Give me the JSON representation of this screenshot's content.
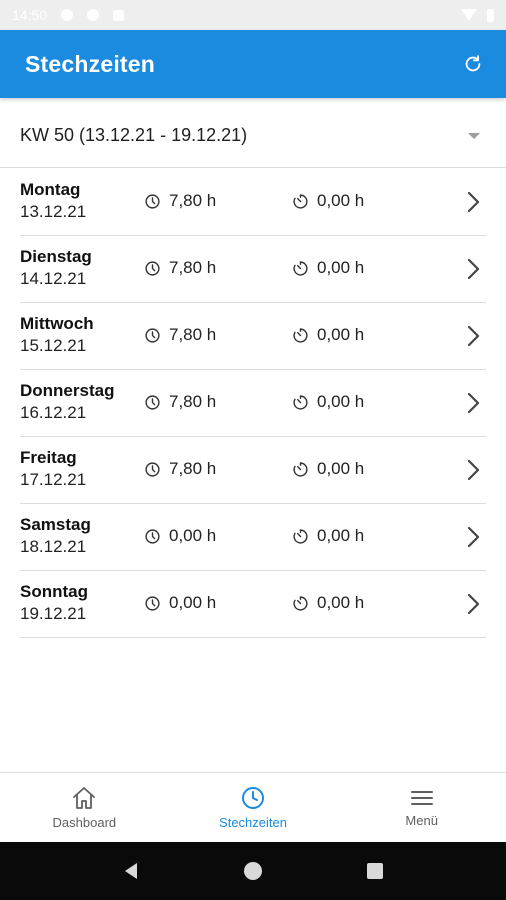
{
  "status_bar": {
    "time": "14:50",
    "icons": [
      "settings-icon",
      "location-icon",
      "notification-icon",
      "wifi-icon",
      "battery-icon"
    ]
  },
  "app_bar": {
    "title": "Stechzeiten",
    "refresh_icon": "refresh-icon",
    "color": "#1b8be0"
  },
  "week_select": {
    "label": "KW 50 (13.12.21 - 19.12.21)"
  },
  "days": [
    {
      "name": "Montag",
      "date": "13.12.21",
      "work": "7,80 h",
      "pause": "0,00 h"
    },
    {
      "name": "Dienstag",
      "date": "14.12.21",
      "work": "7,80 h",
      "pause": "0,00 h"
    },
    {
      "name": "Mittwoch",
      "date": "15.12.21",
      "work": "7,80 h",
      "pause": "0,00 h"
    },
    {
      "name": "Donnerstag",
      "date": "16.12.21",
      "work": "7,80 h",
      "pause": "0,00 h"
    },
    {
      "name": "Freitag",
      "date": "17.12.21",
      "work": "7,80 h",
      "pause": "0,00 h"
    },
    {
      "name": "Samstag",
      "date": "18.12.21",
      "work": "0,00 h",
      "pause": "0,00 h"
    },
    {
      "name": "Sonntag",
      "date": "19.12.21",
      "work": "0,00 h",
      "pause": "0,00 h"
    }
  ],
  "bottom_nav": {
    "items": [
      {
        "label": "Dashboard",
        "icon": "home-icon",
        "active": false
      },
      {
        "label": "Stechzeiten",
        "icon": "clock-icon",
        "active": true
      },
      {
        "label": "Menü",
        "icon": "menu-icon",
        "active": false
      }
    ],
    "active_color": "#1b8be0"
  },
  "system_nav": {
    "icons": [
      "back-icon",
      "home-circle-icon",
      "recents-icon"
    ]
  }
}
